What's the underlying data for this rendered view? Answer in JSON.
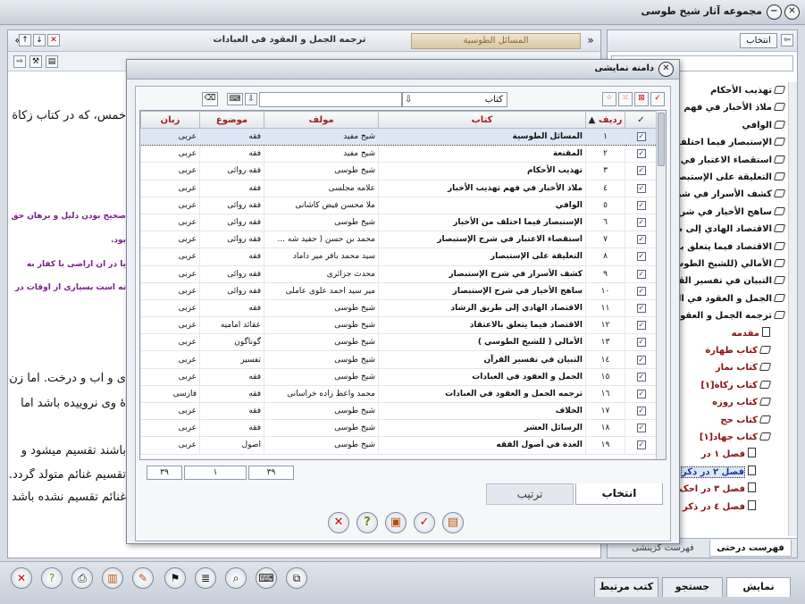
{
  "app": {
    "title": "مجموعه آثار شیخ طوسی"
  },
  "doc": {
    "tab_active": "المسائل الطوسية",
    "tab_second": "ترجمه الجمل و العقود فى العبادات",
    "lines_black_1": "خمس، که در کتاب زکاة",
    "line_purple_1": "صحیح بودن دلیل و برهان حق",
    "line_purple_2": "بود.",
    "line_purple_3": "یا در آن اراضی با کفار به",
    "line_purple_4": "ته است بسیاری از اوقات در",
    "line_black_2": "ی و آب و درخت. اما زن",
    "line_black_3": "هٔ وی نرو‌ییده باشد اما",
    "line_black_4": "باشند تقسیم میشود و",
    "line_black_5": "تقسیم غنائم متولد گردد.",
    "line_black_6": "غنائم تقسیم نشده باشد"
  },
  "right_panel": {
    "select_label": "انتخاب",
    "tree": [
      {
        "label": "تهذیب الأحکام",
        "depth": 0,
        "kind": "book",
        "color": "black"
      },
      {
        "label": "ملاذ الأخبار في فهم تهذ",
        "depth": 0,
        "kind": "book",
        "color": "black"
      },
      {
        "label": "الوافي",
        "depth": 0,
        "kind": "book",
        "color": "black"
      },
      {
        "label": "الإستبصار فيما اختلف م",
        "depth": 0,
        "kind": "book",
        "color": "black"
      },
      {
        "label": "استقصاء الاعتبار في شر",
        "depth": 0,
        "kind": "book",
        "color": "black"
      },
      {
        "label": "التعليقة على الإستبصار",
        "depth": 0,
        "kind": "book",
        "color": "black"
      },
      {
        "label": "كشف الأسرار في شرح ال",
        "depth": 0,
        "kind": "book",
        "color": "black"
      },
      {
        "label": "ساهج الأخيار في شرح",
        "depth": 0,
        "kind": "book",
        "color": "black"
      },
      {
        "label": "الاقتصاد الهادي إلى ط",
        "depth": 0,
        "kind": "book",
        "color": "black"
      },
      {
        "label": "الاقتصاد فيما يتعلق بال",
        "depth": 0,
        "kind": "book",
        "color": "black"
      },
      {
        "label": "الأمالي (للشيخ الطوس",
        "depth": 0,
        "kind": "book",
        "color": "black"
      },
      {
        "label": "التبيان في تفسير القرآ",
        "depth": 0,
        "kind": "book",
        "color": "black"
      },
      {
        "label": "الجمل و العقود في الع",
        "depth": 0,
        "kind": "book",
        "color": "black"
      },
      {
        "label": "ترجمه الجمل و العقود",
        "depth": 0,
        "kind": "openbook",
        "color": "black"
      },
      {
        "label": "مقدمه",
        "depth": 1,
        "kind": "doc",
        "color": "red"
      },
      {
        "label": "كتاب طهارة",
        "depth": 1,
        "kind": "book",
        "color": "red"
      },
      {
        "label": "كتاب نماز",
        "depth": 1,
        "kind": "book",
        "color": "red"
      },
      {
        "label": "كتاب زكاة[۱]",
        "depth": 1,
        "kind": "book",
        "color": "red"
      },
      {
        "label": "كتاب روزه",
        "depth": 1,
        "kind": "book",
        "color": "red"
      },
      {
        "label": "كتاب حج",
        "depth": 1,
        "kind": "book",
        "color": "red"
      },
      {
        "label": "كتاب جهاد[۱]",
        "depth": 1,
        "kind": "openbook",
        "color": "red"
      },
      {
        "label": "فصل ۱ در",
        "depth": 2,
        "kind": "doc",
        "color": "red"
      },
      {
        "label": "فصل ۲ در ذکر",
        "depth": 2,
        "kind": "doc",
        "color": "blue"
      },
      {
        "label": "فصل ۳ در احک",
        "depth": 2,
        "kind": "doc",
        "color": "red"
      },
      {
        "label": "فصل ٤ در ذکر",
        "depth": 2,
        "kind": "doc",
        "color": "red"
      }
    ],
    "tab_tree": "فهرست درختی",
    "tab_choice": "فهرست گزینشی"
  },
  "bottom": {
    "tab_show": "نمایش",
    "tab_search": "جستجو",
    "tab_related": "كتب مرتبط"
  },
  "dialog": {
    "title": "دامنه نمایشی",
    "book_combo": "کتاب",
    "headers": {
      "check": "✓",
      "row": "ردیف",
      "book": "کتاب",
      "author": "مولف",
      "topic": "موضوع",
      "lang": "زبان"
    },
    "rows": [
      {
        "n": "١",
        "book": "المسائل الطوسية",
        "author": "شيخ مفيد",
        "topic": "فقه",
        "lang": "عربی"
      },
      {
        "n": "٢",
        "book": "المقنعة",
        "author": "شيخ مفيد",
        "topic": "فقه",
        "lang": "عربی"
      },
      {
        "n": "٣",
        "book": "تهذیب الأحکام",
        "author": "شيخ طوسى",
        "topic": "فقه روائى",
        "lang": "عربی"
      },
      {
        "n": "٤",
        "book": "ملاذ الأخبار في فهم تهذيب الأخبار",
        "author": "علامه مجلسى",
        "topic": "فقه",
        "lang": "عربی"
      },
      {
        "n": "٥",
        "book": "الوافي",
        "author": "ملا محسن فيض كاشانى",
        "topic": "فقه روائى",
        "lang": "عربی"
      },
      {
        "n": "٦",
        "book": "الإستبصار فيما اختلف من الأخبار",
        "author": "شيخ طوسى",
        "topic": "فقه روائى",
        "lang": "عربی"
      },
      {
        "n": "٧",
        "book": "استقصاء الاعتبار في شرح الإستبصار",
        "author": "محمد بن حسن ( حفيد شه ...",
        "topic": "فقه روائى",
        "lang": "عربی"
      },
      {
        "n": "٨",
        "book": "التعليقة على الإستبصار",
        "author": "سيد محمد باقر مير داماد",
        "topic": "فقه",
        "lang": "عربی"
      },
      {
        "n": "٩",
        "book": "كشف الأسرار في شرح الإستبصار",
        "author": "محدث جزائرى",
        "topic": "فقه روائى",
        "lang": "عربی"
      },
      {
        "n": "١٠",
        "book": "ساهج الأخيار في شرح الإستبصار",
        "author": "مير سيد احمد علوى عاملى",
        "topic": "فقه روائى",
        "lang": "عربی"
      },
      {
        "n": "١١",
        "book": "الاقتصاد الهادي إلى طريق الرشاد",
        "author": "شيخ طوسى",
        "topic": "فقه",
        "lang": "عربی"
      },
      {
        "n": "١٢",
        "book": "الاقتصاد فيما يتعلق بالاعتقاد",
        "author": "شيخ طوسى",
        "topic": "عقائد اماميه",
        "lang": "عربی"
      },
      {
        "n": "١٣",
        "book": "الأمالي ( للشيخ الطوسي )",
        "author": "شيخ طوسى",
        "topic": "گوناگون",
        "lang": "عربی"
      },
      {
        "n": "١٤",
        "book": "التبيان في تفسير القرآن",
        "author": "شيخ طوسى",
        "topic": "تفسير",
        "lang": "عربی"
      },
      {
        "n": "١٥",
        "book": "الجمل و العقود في العبادات",
        "author": "شيخ طوسى",
        "topic": "فقه",
        "lang": "عربی"
      },
      {
        "n": "١٦",
        "book": "ترجمه الجمل و العقود في العبادات",
        "author": "محمد واعظ زاده خراسانى",
        "topic": "فقه",
        "lang": "فارسی"
      },
      {
        "n": "١٧",
        "book": "الخلاف",
        "author": "شيخ طوسى",
        "topic": "فقه",
        "lang": "عربی"
      },
      {
        "n": "١٨",
        "book": "الرسائل العشر",
        "author": "شيخ طوسى",
        "topic": "فقه",
        "lang": "عربی"
      },
      {
        "n": "١٩",
        "book": "العدة في أصول الفقه",
        "author": "شيخ طوسى",
        "topic": "اصول",
        "lang": "عربی"
      }
    ],
    "pager": {
      "total_left": "۳۹",
      "current": "۱",
      "total_right": "۳۹"
    },
    "tab_select": "انتخاب",
    "tab_sort": "ترتیب"
  }
}
